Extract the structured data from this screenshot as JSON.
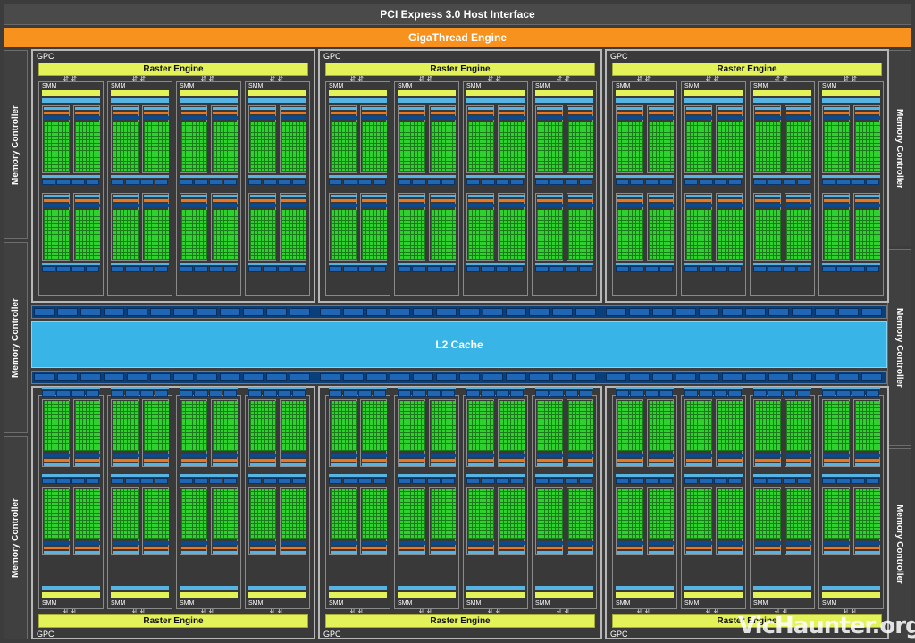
{
  "host_interface": "PCI Express 3.0 Host Interface",
  "thread_engine": "GigaThread Engine",
  "l2_cache": "L2 Cache",
  "memory_controller_label": "Memory Controller",
  "gpc_label": "GPC",
  "raster_engine_label": "Raster Engine",
  "smm_label": "SMM",
  "watermark": "VicHaunter.org",
  "colors": {
    "background": "#3c3c3c",
    "thread_engine": "#f7921e",
    "raster_engine": "#e4f25a",
    "l2_cache": "#39b4e6",
    "cuda_core": "#2ed12e",
    "dispatch_unit": "#1f66b5",
    "scheduler": "#e87722"
  }
}
